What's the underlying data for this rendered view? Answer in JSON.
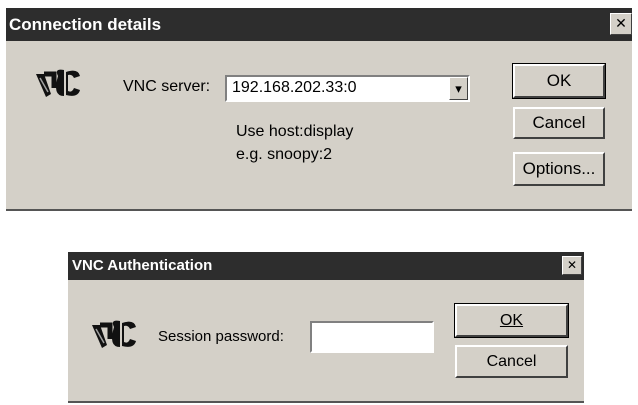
{
  "connection_dialog": {
    "title": "Connection details",
    "close_glyph": "✕",
    "server_label": "VNC server:",
    "server_value": "192.168.202.33:0",
    "dropdown_glyph": "▾",
    "hint_line1": "Use host:display",
    "hint_line2": "e.g. snoopy:2",
    "ok_label": "OK",
    "cancel_label": "Cancel",
    "options_label": "Options..."
  },
  "auth_dialog": {
    "title": "VNC Authentication",
    "close_glyph": "✕",
    "password_label": "Session password:",
    "password_value": "",
    "ok_label": "OK",
    "cancel_label": "Cancel"
  },
  "colors": {
    "titlebar": "#2d2d2d",
    "dialog_face": "#d4d0c8"
  },
  "icons": [
    "vnc-logo-icon",
    "close-icon",
    "dropdown-arrow-icon"
  ]
}
